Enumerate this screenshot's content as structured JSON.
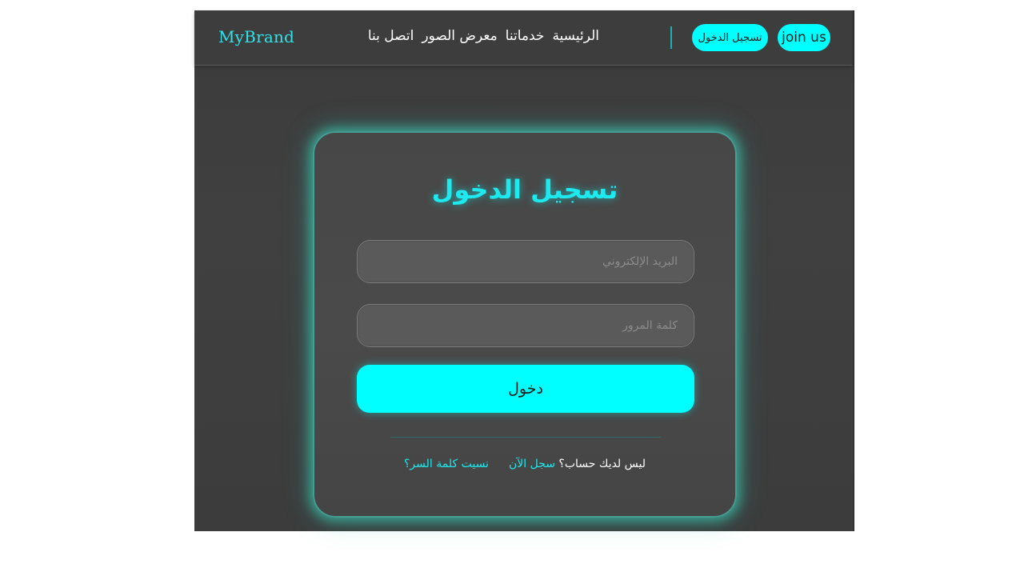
{
  "navbar": {
    "brand": "MyBrand",
    "links": [
      {
        "label": "الرئيسية"
      },
      {
        "label": "خدماتنا"
      },
      {
        "label": "معرض الصور"
      },
      {
        "label": "اتصل بنا"
      }
    ],
    "login_button": "تسجيل الدخول",
    "join_button": "join us"
  },
  "login_card": {
    "title": "تسجيل الدخول",
    "email_placeholder": "البريد الإلكتروني",
    "password_placeholder": "كلمة المرور",
    "submit_label": "دخول",
    "no_account_text": "ليس لديك حساب؟",
    "register_link": "سجل الآن",
    "forgot_link": "نسيت كلمة السر؟"
  },
  "colors": {
    "accent": "#00ffff",
    "background": "#3d3d3d",
    "card": "#484848"
  }
}
